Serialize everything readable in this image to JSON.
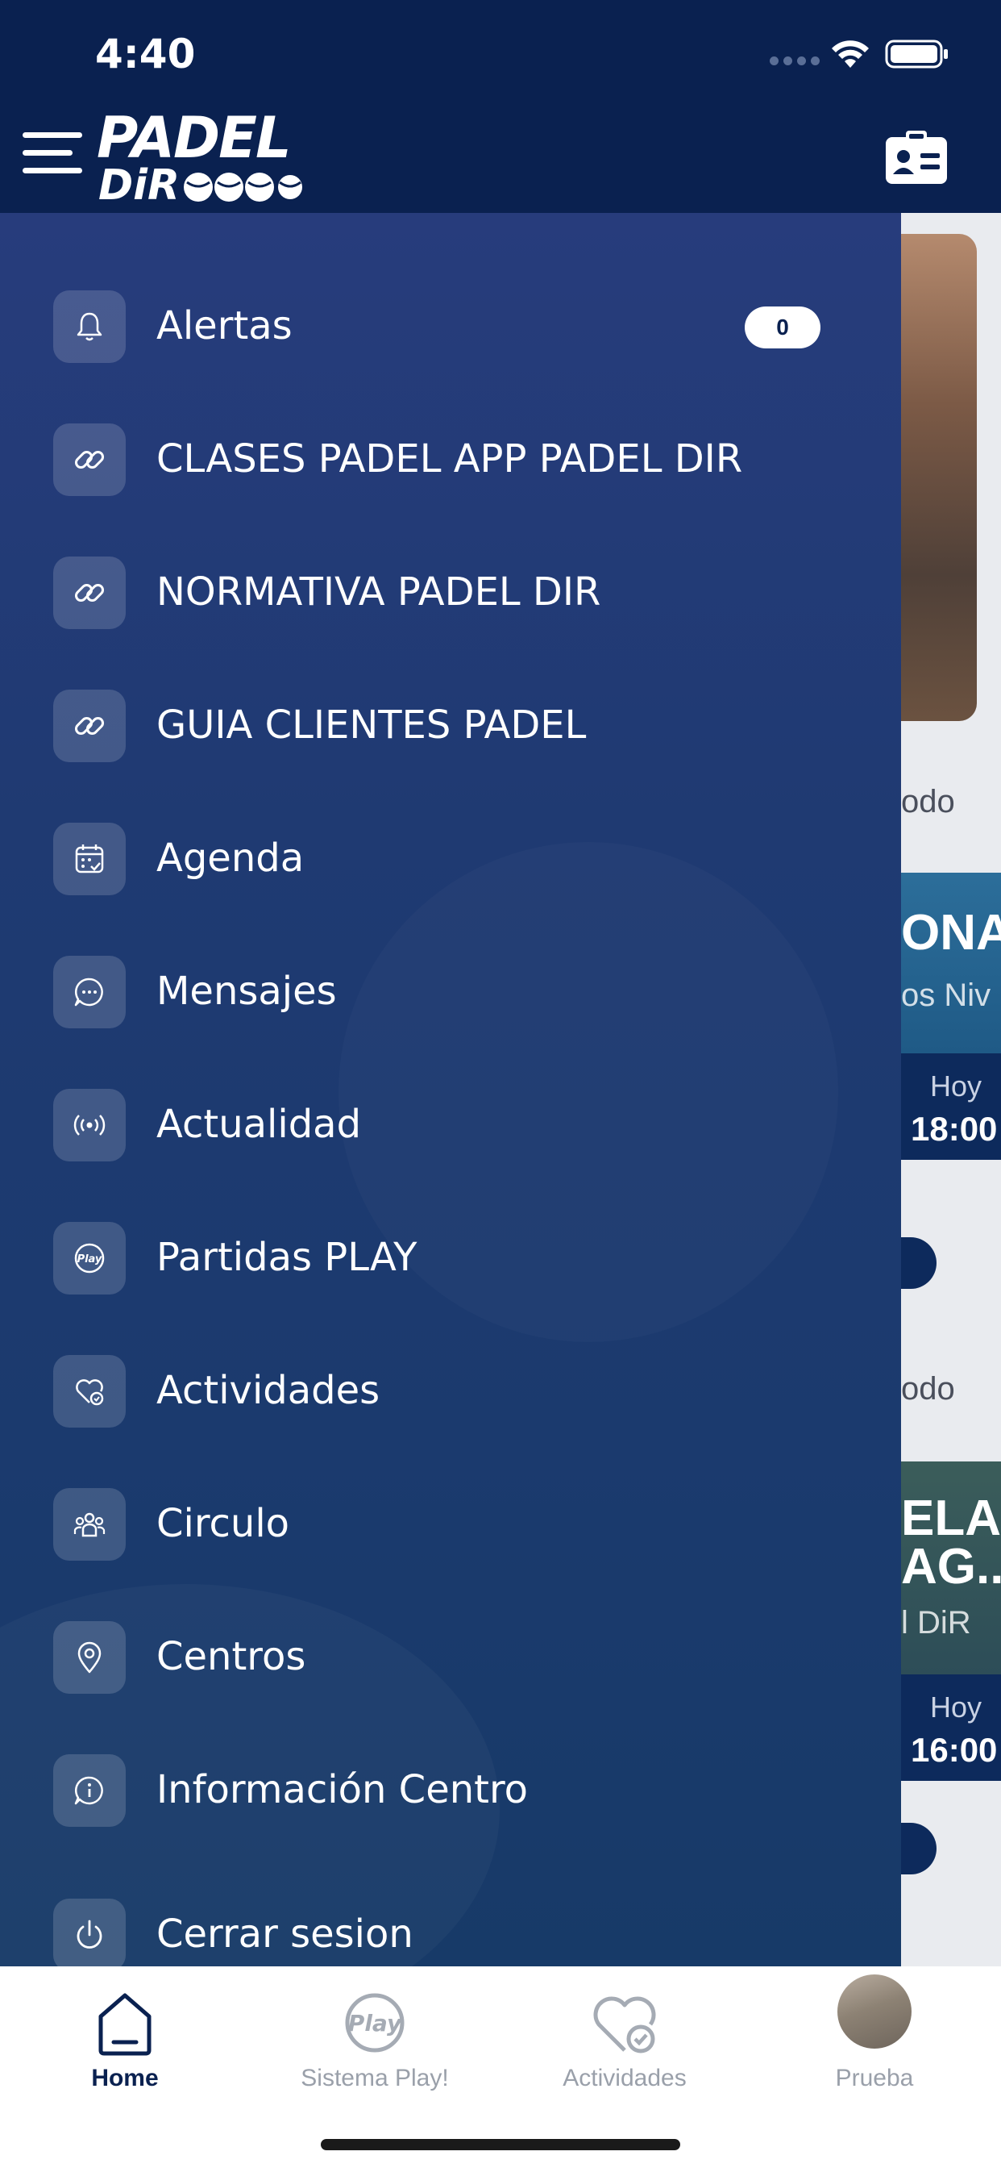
{
  "status_bar": {
    "time": "4:40"
  },
  "header": {
    "logo_line1": "PADEL",
    "logo_line2": "DiR",
    "menu_icon": "hamburger-menu-icon",
    "right_icon": "id-card-icon"
  },
  "drawer": {
    "items": [
      {
        "label": "Alertas",
        "icon": "bell-icon",
        "badge": "0"
      },
      {
        "label": "CLASES PADEL APP PADEL DIR",
        "icon": "link-icon"
      },
      {
        "label": "NORMATIVA PADEL DIR",
        "icon": "link-icon"
      },
      {
        "label": "GUIA CLIENTES PADEL",
        "icon": "link-icon"
      },
      {
        "label": "Agenda",
        "icon": "calendar-icon"
      },
      {
        "label": "Mensajes",
        "icon": "chat-bubble-icon"
      },
      {
        "label": "Actualidad",
        "icon": "broadcast-icon"
      },
      {
        "label": "Partidas PLAY",
        "icon": "play-logo-icon"
      },
      {
        "label": "Actividades",
        "icon": "heart-check-icon"
      },
      {
        "label": "Circulo",
        "icon": "group-icon"
      },
      {
        "label": "Centros",
        "icon": "location-pin-icon"
      },
      {
        "label": "Información Centro",
        "icon": "info-bubble-icon"
      },
      {
        "label": "Cerrar sesion",
        "icon": "power-icon"
      }
    ]
  },
  "background_peek": {
    "section_text_1": "odo",
    "card1_title": "ONA",
    "card1_sub": "os Niv",
    "card1_day": "Hoy",
    "card1_time": "18:00",
    "section_text_2": "odo",
    "card2_title_a": "ELA",
    "card2_title_b": "AG..",
    "card2_sub": "l DiR",
    "card2_day": "Hoy",
    "card2_time": "16:00"
  },
  "tabbar": {
    "tabs": [
      {
        "label": "Home",
        "icon": "home-icon",
        "active": true
      },
      {
        "label": "Sistema Play!",
        "icon": "play-logo-icon",
        "active": false
      },
      {
        "label": "Actividades",
        "icon": "heart-check-icon",
        "active": false
      },
      {
        "label": "Prueba",
        "icon": "avatar",
        "active": false
      }
    ]
  },
  "colors": {
    "header": "#0a2150",
    "drawer_top": "#273c7c",
    "drawer_bottom": "#173a68",
    "active_tab": "#0a2150",
    "inactive_tab": "#9aa0aa"
  }
}
